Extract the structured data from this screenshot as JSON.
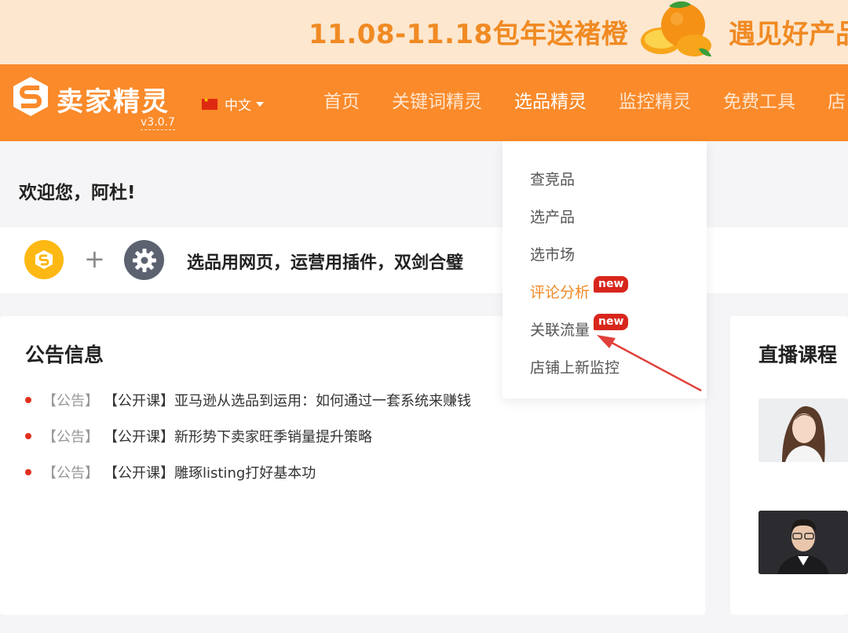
{
  "promo": {
    "date_text": "11.08-11.18包年送褚橙",
    "tagline": "遇见好产品"
  },
  "header": {
    "brand": "卖家精灵",
    "version": "v3.0.7",
    "language": "中文",
    "nav": [
      {
        "label": "首页"
      },
      {
        "label": "关键词精灵"
      },
      {
        "label": "选品精灵"
      },
      {
        "label": "监控精灵"
      },
      {
        "label": "免费工具"
      },
      {
        "label": "店"
      }
    ]
  },
  "welcome": "欢迎您，阿杜!",
  "plugin_bar": {
    "plus": "+",
    "slogan": "选品用网页，运营用插件，双剑合璧"
  },
  "dropdown": {
    "items": [
      {
        "label": "查竞品"
      },
      {
        "label": "选产品"
      },
      {
        "label": "选市场"
      },
      {
        "label": "评论分析",
        "badge": "new"
      },
      {
        "label": "关联流量",
        "badge": "new"
      },
      {
        "label": "店铺上新监控"
      }
    ]
  },
  "notices": {
    "title": "公告信息",
    "items": [
      {
        "tag": "【公告】",
        "text": "【公开课】亚马逊从选品到运用：如何通过一套系统来赚钱"
      },
      {
        "tag": "【公告】",
        "text": "【公开课】新形势下卖家旺季销量提升策略"
      },
      {
        "tag": "【公告】",
        "text": "【公开课】雕琢listing打好基本功"
      }
    ]
  },
  "live": {
    "title": "直播课程"
  },
  "colors": {
    "brand_orange": "#fa8a2a",
    "badge_red": "#d8261c",
    "annotation_arrow": "#e0403a"
  }
}
